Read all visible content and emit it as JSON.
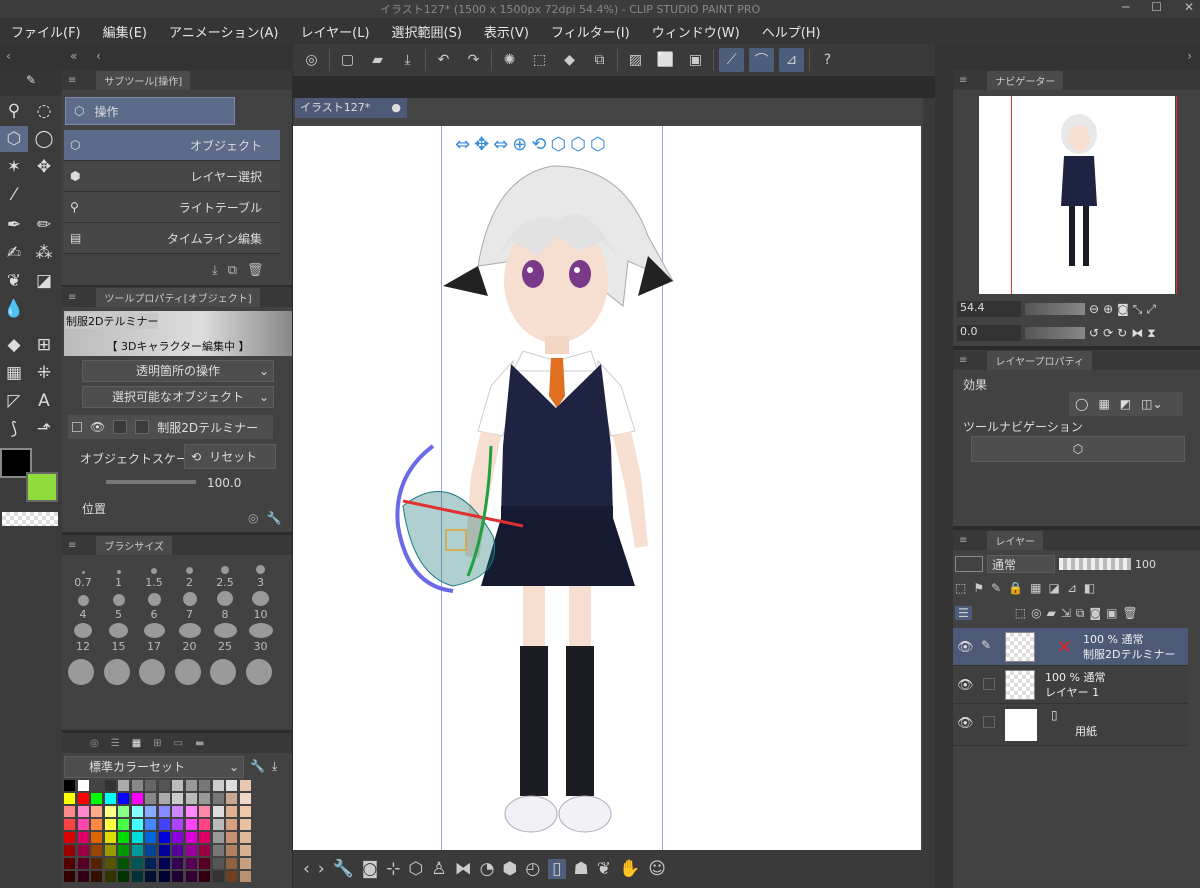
{
  "window": {
    "title": "イラスト127* (1500 x 1500px 72dpi 54.4%)  - CLIP STUDIO PAINT PRO"
  },
  "menu": [
    "ファイル(F)",
    "編集(E)",
    "アニメーション(A)",
    "レイヤー(L)",
    "選択範囲(S)",
    "表示(V)",
    "フィルター(I)",
    "ウィンドウ(W)",
    "ヘルプ(H)"
  ],
  "subtool": {
    "header": "サブツール[操作]",
    "group": "操作",
    "items": [
      "オブジェクト",
      "レイヤー選択",
      "ライトテーブル",
      "タイムライン編集"
    ]
  },
  "toolprop": {
    "header": "ツールプロパティ[オブジェクト]",
    "object_name": "制服2Dテルミナー",
    "status": "【 3Dキャラクター編集中 】",
    "transparent_op": "透明箇所の操作",
    "selectable": "選択可能なオブジェクト",
    "layer_object": "制服2Dテルミナー",
    "scale_label": "オブジェクトスケール",
    "reset": "リセット",
    "scale_value": "100.0",
    "position_label": "位置"
  },
  "brushsize": {
    "header": "ブラシサイズ",
    "sizes": [
      "0.7",
      "1",
      "1.5",
      "2",
      "2.5",
      "3",
      "4",
      "5",
      "6",
      "7",
      "8",
      "10",
      "12",
      "15",
      "17",
      "20",
      "25",
      "30"
    ]
  },
  "colorset": {
    "name": "標準カラーセット"
  },
  "canvas": {
    "tab": "イラスト127*"
  },
  "navigator": {
    "header": "ナビゲーター",
    "zoom": "54.4",
    "angle": "0.0"
  },
  "layerprop": {
    "header": "レイヤープロパティ",
    "effect": "効果",
    "toolnav": "ツールナビゲーション"
  },
  "layers": {
    "header": "レイヤー",
    "blend": "通常",
    "opacity": "100",
    "items": [
      {
        "line1": "100 % 通常",
        "line2": "制服2Dテルミナー"
      },
      {
        "line1": "100 % 通常",
        "line2": "レイヤー 1"
      },
      {
        "line1": "",
        "line2": "用紙"
      }
    ]
  },
  "colors": {
    "main": "#000000",
    "sub": "#8fdc3c",
    "accent": "#5d6b8a"
  }
}
